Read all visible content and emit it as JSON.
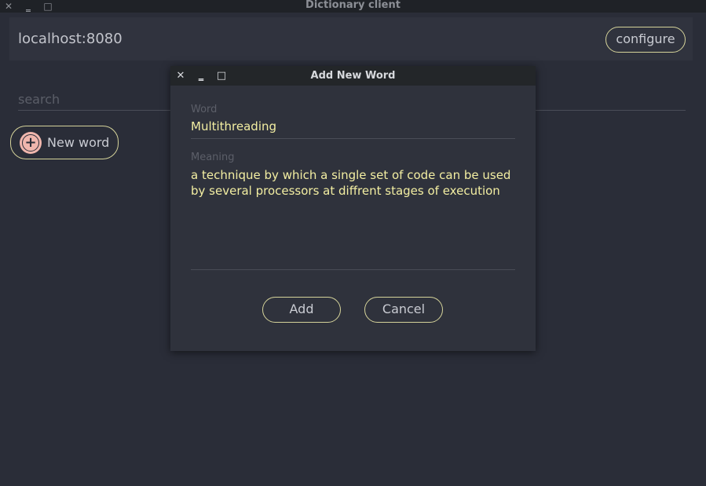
{
  "window": {
    "title": "Dictionary client",
    "controls": {
      "close": "✕",
      "minimize": "‗",
      "maximize": "□"
    }
  },
  "host": {
    "address": "localhost:8080",
    "configure_label": "configure"
  },
  "search": {
    "placeholder": "search",
    "value": ""
  },
  "new_word_button": {
    "label": "New word",
    "icon": "plus-circle-icon",
    "icon_glyph": "+"
  },
  "dialog": {
    "title": "Add New Word",
    "controls": {
      "close": "✕",
      "minimize": "‗",
      "maximize": "□"
    },
    "word_label": "Word",
    "word_value": "Multithreading",
    "meaning_label": "Meaning",
    "meaning_value": "a technique by which a single set of code can be used by several processors at diffrent stages of execution",
    "add_label": "Add",
    "cancel_label": "Cancel"
  },
  "colors": {
    "background": "#2a2d38",
    "accent_border": "#d5d39a",
    "input_text": "#f3eea2",
    "icon_fill": "#f0b6ad"
  }
}
